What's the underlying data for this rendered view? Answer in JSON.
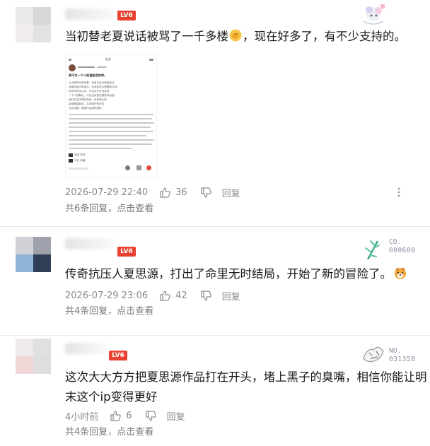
{
  "comments": [
    {
      "level_badge": "LV6",
      "text": "当初替老夏说话被骂了一千多楼",
      "text_after_emoji": "，现在好多了，有不少支持的。",
      "emoji": "hand-emoji",
      "embedded_image": {
        "tab": "全文",
        "headline": "我不为一个人的渲染而欢呼。",
        "body_lines": [
          "从近期的动态来看，作者已经在积极回应",
          "读者的疑问和批评，对此我表示理解和支持。",
          "但同时我也认为，评论区不应该变成",
          "一个人的舞台，讨论应该更加理性和包容。",
          "我们欢迎不同的声音，也希望大家",
          "能够尊重彼此，共同维护良好的",
          "社区氛围。希望作品越来越好。"
        ],
        "footer_lines": [
          "阅读  赞同",
          "评论  收藏"
        ]
      },
      "timestamp": "2026-07-29 22:40",
      "likes": "36",
      "reply_label": "回复",
      "replies_link": "共6条回复，点击查看"
    },
    {
      "level_badge": "LV6",
      "text": "传奇抗压人夏思源，打出了命里无时结局，开始了新的冒险了。",
      "emoji": "dog-emoji",
      "fan_badge": {
        "label": "CO.",
        "number": "000600"
      },
      "timestamp": "2026-07-29 23:06",
      "likes": "42",
      "reply_label": "回复",
      "replies_link": "共4条回复，点击查看"
    },
    {
      "level_badge": "LV6",
      "text_line1": "这次大大方方把夏思源作品打在开头，堵上黑子的臭嘴，相信你能让明",
      "text_line2": "末这个ip变得更好",
      "fan_badge": {
        "label": "NO.",
        "number": "031358"
      },
      "timestamp": "4小时前",
      "likes": "6",
      "reply_label": "回复",
      "replies_link": "共4条回复，点击查看"
    }
  ],
  "colors": {
    "level_badge": "#e8412f",
    "meta_text": "#8a8a8a",
    "divider": "#e9e9e9"
  }
}
